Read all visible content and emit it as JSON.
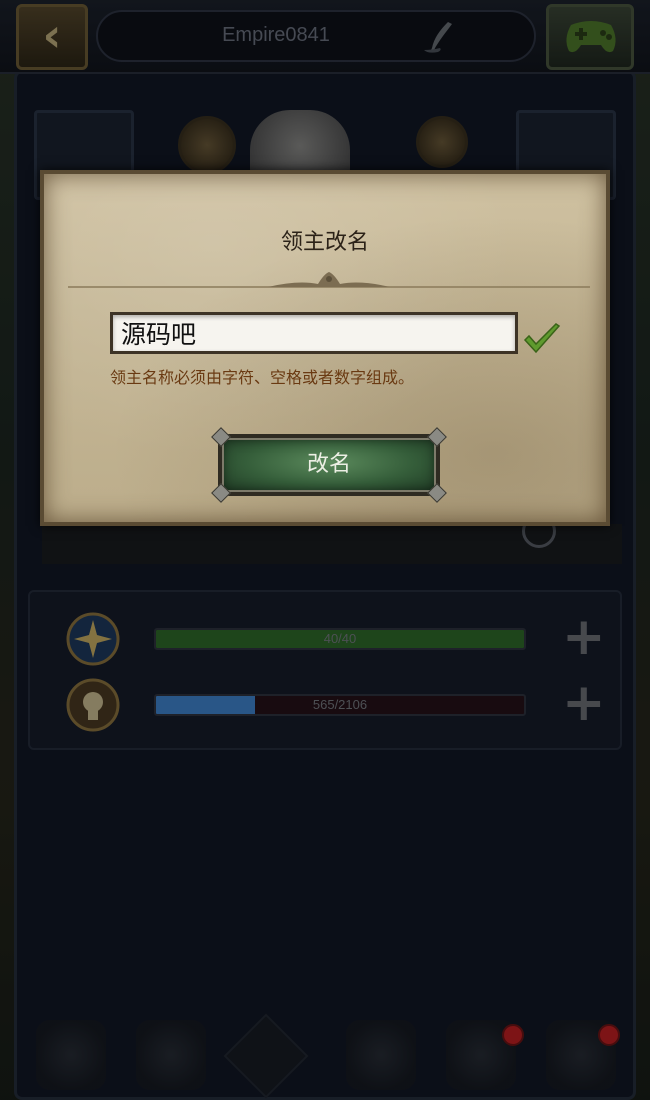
{
  "topbar": {
    "back_icon": "back-arrow-icon",
    "player_name": "Empire0841",
    "edit_icon": "quill-icon",
    "controller_icon": "gamepad-icon"
  },
  "stats": [
    {
      "icon": "shield-cross-icon",
      "text": "40/40",
      "fill_fraction": 1.0,
      "color": "#2e6b2a"
    },
    {
      "icon": "experience-icon",
      "text": "565/2106",
      "fill_fraction": 0.27,
      "color": "#3f84d0"
    }
  ],
  "bottom_nav": {
    "items": [
      {
        "icon": "trophy-icon",
        "badge": false
      },
      {
        "icon": "crest-icon",
        "badge": false
      },
      {
        "icon": "diamond-icon",
        "badge": false
      },
      {
        "icon": "swirl-icon",
        "badge": false
      },
      {
        "icon": "book-icon",
        "badge": true
      },
      {
        "icon": "gear-icon",
        "badge": true
      }
    ]
  },
  "dialog": {
    "title": "领主改名",
    "input_value": "源码吧",
    "hint": "领主名称必须由字符、空格或者数字组成。",
    "confirm_icon": "checkmark-icon",
    "button_label": "改名"
  },
  "colors": {
    "hint_text": "#6a3a12",
    "button_green": "#355e3a",
    "check_green": "#5f9a2e"
  }
}
